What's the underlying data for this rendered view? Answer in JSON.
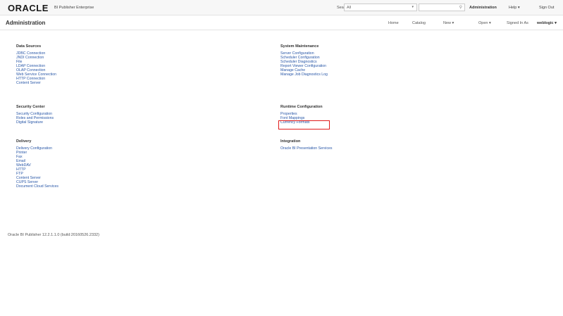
{
  "header": {
    "logo": "ORACLE",
    "product": "BI Publisher Enterprise",
    "search_label": "Search",
    "search_scope": "All",
    "links": {
      "administration": "Administration",
      "help": "Help",
      "sign_out": "Sign Out"
    }
  },
  "subheader": {
    "title": "Administration",
    "links": {
      "home": "Home",
      "catalog": "Catalog",
      "new": "New",
      "open": "Open",
      "signed_in_as": "Signed In As",
      "user": "weblogic"
    }
  },
  "sections": {
    "data_sources": {
      "title": "Data Sources",
      "items": [
        "JDBC Connection",
        "JNDI Connection",
        "File",
        "LDAP Connection",
        "OLAP Connection",
        "Web Service Connection",
        "HTTP Connection",
        "Content Server"
      ]
    },
    "system_maintenance": {
      "title": "System Maintenance",
      "items": [
        "Server Configuration",
        "Scheduler Configuration",
        "Scheduler Diagnostics",
        "Report Viewer Configuration",
        "Manage Cache",
        "Manage Job Diagnostics Log"
      ]
    },
    "security_center": {
      "title": "Security Center",
      "items": [
        "Security Configuration",
        "Roles and Permissions",
        "Digital Signature"
      ]
    },
    "runtime_configuration": {
      "title": "Runtime Configuration",
      "items": [
        "Properties",
        "Font Mappings",
        "Currency Formats"
      ]
    },
    "delivery": {
      "title": "Delivery",
      "items": [
        "Delivery Configuration",
        "Printer",
        "Fax",
        "Email",
        "WebDAV",
        "HTTP",
        "FTP",
        "Content Server",
        "CUPS Server",
        "Document Cloud Services"
      ]
    },
    "integration": {
      "title": "Integration",
      "items": [
        "Oracle BI Presentation Services"
      ]
    }
  },
  "footer": "Oracle BI Publisher 12.2.1.1.0 (build:20160526.2332)",
  "colors": {
    "link": "#2a58a8",
    "highlight": "#e01b1b"
  }
}
